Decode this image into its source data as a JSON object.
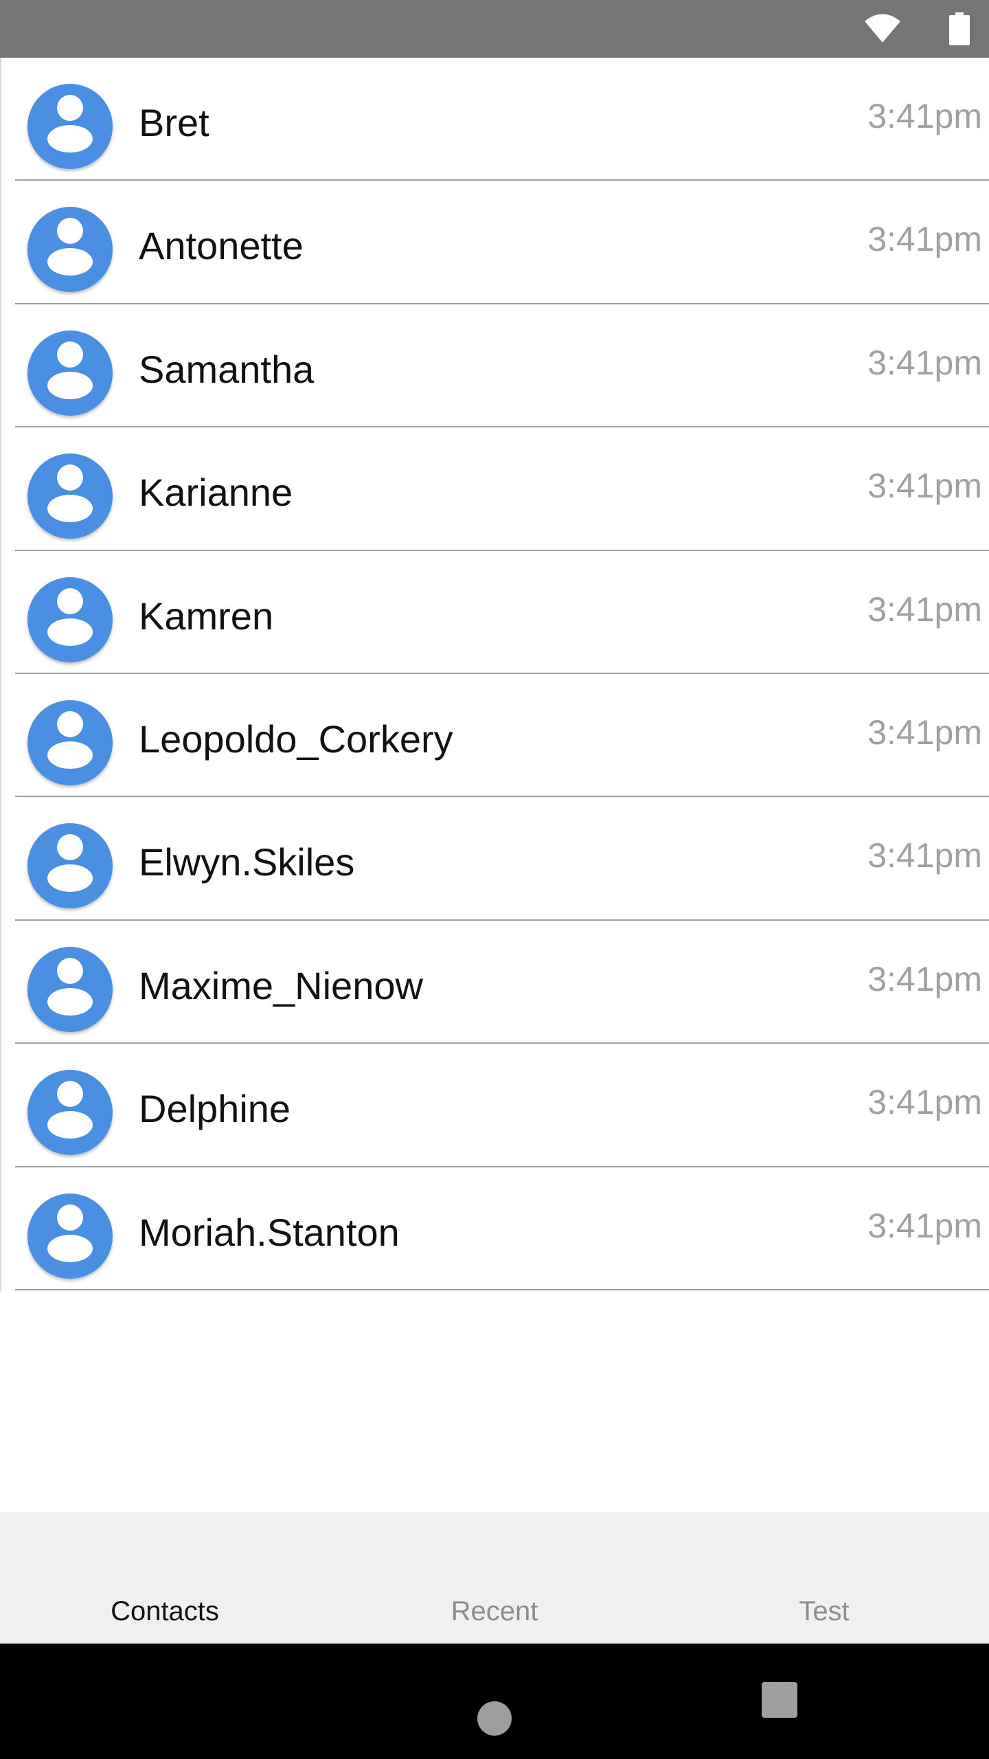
{
  "status_bar": {
    "icons": [
      "wifi-icon",
      "battery-icon"
    ],
    "background": "#757575"
  },
  "contacts": [
    {
      "name": "Bret",
      "time": "3:41pm"
    },
    {
      "name": "Antonette",
      "time": "3:41pm"
    },
    {
      "name": "Samantha",
      "time": "3:41pm"
    },
    {
      "name": "Karianne",
      "time": "3:41pm"
    },
    {
      "name": "Kamren",
      "time": "3:41pm"
    },
    {
      "name": "Leopoldo_Corkery",
      "time": "3:41pm"
    },
    {
      "name": "Elwyn.Skiles",
      "time": "3:41pm"
    },
    {
      "name": "Maxime_Nienow",
      "time": "3:41pm"
    },
    {
      "name": "Delphine",
      "time": "3:41pm"
    },
    {
      "name": "Moriah.Stanton",
      "time": "3:41pm"
    }
  ],
  "avatar": {
    "icon": "person-icon",
    "color": "#4a90e2"
  },
  "tabs": [
    {
      "label": "Contacts",
      "active": true
    },
    {
      "label": "Recent",
      "active": false
    },
    {
      "label": "Test",
      "active": false
    }
  ],
  "nav_bar": {
    "icons": [
      "home-icon",
      "recents-icon"
    ]
  }
}
